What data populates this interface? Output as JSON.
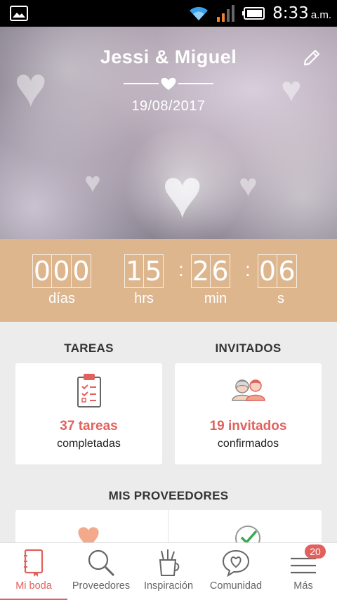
{
  "status_bar": {
    "time": "8:33",
    "ampm": "a.m.",
    "icons": [
      "image-icon",
      "wifi-icon",
      "signal-icon",
      "battery-icon"
    ]
  },
  "hero": {
    "couple_names": "Jessi & Miguel",
    "wedding_date": "19/08/2017"
  },
  "countdown": {
    "days": [
      "0",
      "0",
      "0"
    ],
    "hours": [
      "1",
      "5"
    ],
    "minutes": [
      "2",
      "6"
    ],
    "seconds": [
      "0",
      "6"
    ],
    "labels": {
      "days": "días",
      "hours": "hrs",
      "minutes": "min",
      "seconds": "s"
    },
    "separator": ":"
  },
  "tasks": {
    "section_title": "TAREAS",
    "count": "37 tareas",
    "subtitle": "completadas"
  },
  "guests": {
    "section_title": "INVITADOS",
    "count": "19 invitados",
    "subtitle": "confirmados"
  },
  "vendors": {
    "section_title": "MIS PROVEEDORES"
  },
  "nav": {
    "items": [
      {
        "label": "Mi boda",
        "icon": "notebook-icon"
      },
      {
        "label": "Proveedores",
        "icon": "search-icon"
      },
      {
        "label": "Inspiración",
        "icon": "pencil-cup-icon"
      },
      {
        "label": "Comunidad",
        "icon": "heart-chat-icon"
      },
      {
        "label": "Más",
        "icon": "menu-icon"
      }
    ],
    "badge": "20"
  },
  "colors": {
    "accent": "#e1615d",
    "countdown_bg": "#ddb68e",
    "page_bg": "#ececec"
  }
}
